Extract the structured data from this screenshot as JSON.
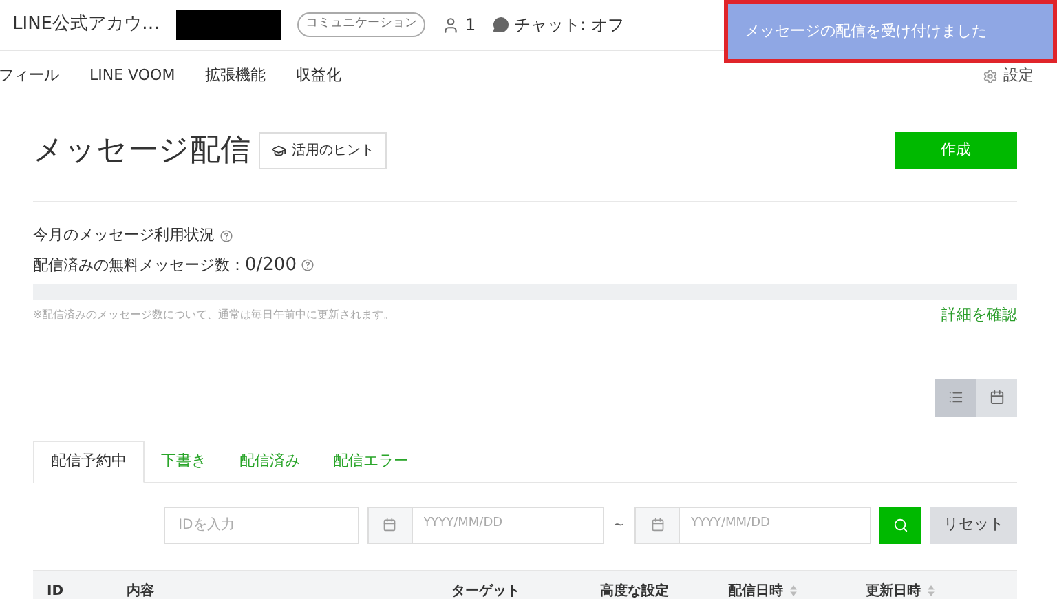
{
  "header": {
    "account_name": "LINE公式アカウ…",
    "badge": "コミュニケーション",
    "member_count": "1",
    "chat_status": "チャット: オフ"
  },
  "toast": {
    "message": "メッセージの配信を受け付けました"
  },
  "nav": {
    "items": [
      {
        "label": "フィール"
      },
      {
        "label": "LINE VOOM"
      },
      {
        "label": "拡張機能"
      },
      {
        "label": "収益化"
      }
    ],
    "settings": "設定"
  },
  "page": {
    "title": "メッセージ配信",
    "hint_button": "活用のヒント",
    "create_button": "作成"
  },
  "usage": {
    "heading": "今月のメッセージ利用状況",
    "count_label": "配信済みの無料メッセージ数：",
    "count": "0/200",
    "note": "※配信済みのメッセージ数について、通常は毎日午前中に更新されます。",
    "details_link": "詳細を確認"
  },
  "view_toggle": [
    {
      "kind": "list",
      "selected": true
    },
    {
      "kind": "calendar",
      "selected": false
    }
  ],
  "tabs": [
    {
      "label": "配信予約中",
      "selected": true
    },
    {
      "label": "下書き",
      "selected": false
    },
    {
      "label": "配信済み",
      "selected": false
    },
    {
      "label": "配信エラー",
      "selected": false
    }
  ],
  "filters": {
    "id_placeholder": "IDを入力",
    "start_placeholder": "YYYY/MM/DD",
    "separator": "~",
    "end_placeholder": "YYYY/MM/DD",
    "reset": "リセット"
  },
  "table": {
    "columns": [
      {
        "label": "ID",
        "sortable": false
      },
      {
        "label": "内容",
        "sortable": false
      },
      {
        "label": "ターゲット",
        "sortable": false
      },
      {
        "label": "高度な設定",
        "sortable": false
      },
      {
        "label": "配信日時",
        "sortable": true
      },
      {
        "label": "更新日時",
        "sortable": true
      }
    ]
  }
}
